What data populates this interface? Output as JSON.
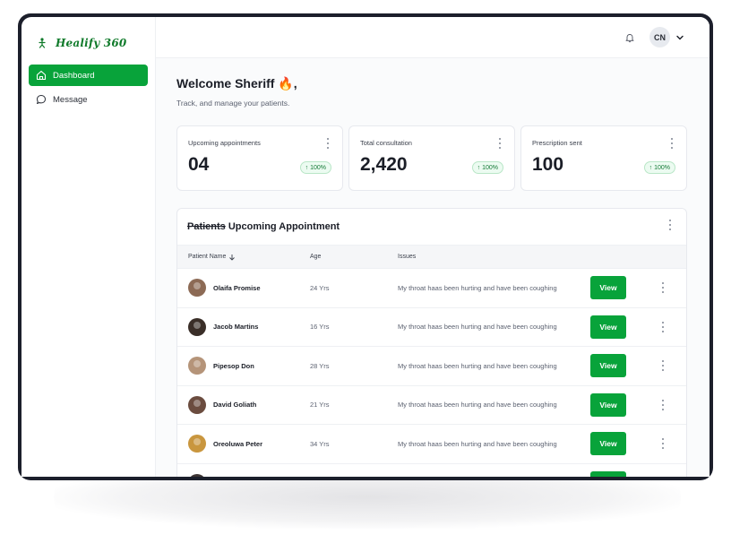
{
  "brand": {
    "name": "Healify 360",
    "color": "#0f7a2a"
  },
  "sidebar": {
    "items": [
      {
        "label": "Dashboard",
        "icon": "home-icon",
        "active": true
      },
      {
        "label": "Message",
        "icon": "chat-bubble-icon",
        "active": false
      }
    ]
  },
  "topbar": {
    "avatar_initials": "CN",
    "icons": [
      "bell-icon",
      "chevron-down-icon"
    ]
  },
  "welcome": {
    "title": "Welcome Sheriff 🔥,",
    "subtitle": "Track, and manage your patients."
  },
  "stats": [
    {
      "label": "Upcoming appointments",
      "value": "04",
      "badge": "100%"
    },
    {
      "label": "Total consultation",
      "value": "2,420",
      "badge": "100%"
    },
    {
      "label": "Prescription sent",
      "value": "100",
      "badge": "100%"
    }
  ],
  "appointments": {
    "title_struck": "Patients",
    "title_rest": " Upcoming Appointment",
    "columns": {
      "name": "Patient Name",
      "age": "Age",
      "issues": "Issues"
    },
    "rows": [
      {
        "name": "Olaifa Promise",
        "age": "24 Yrs",
        "issue": "My throat haas been hurting and have been coughing",
        "action": "View",
        "avatar_color": "#8c6a55"
      },
      {
        "name": "Jacob Martins",
        "age": "16 Yrs",
        "issue": "My throat haas been hurting and have been coughing",
        "action": "View",
        "avatar_color": "#3a2e28"
      },
      {
        "name": "Pipesop Don",
        "age": "28 Yrs",
        "issue": "My throat haas been hurting and have been coughing",
        "action": "View",
        "avatar_color": "#b59479"
      },
      {
        "name": "David Goliath",
        "age": "21 Yrs",
        "issue": "My throat haas been hurting and have been coughing",
        "action": "View",
        "avatar_color": "#6b4c3f"
      },
      {
        "name": "Oreoluwa Peter",
        "age": "34 Yrs",
        "issue": "My throat haas been hurting and have been coughing",
        "action": "View",
        "avatar_color": "#c9963e"
      },
      {
        "name": "",
        "age": "",
        "issue": "",
        "action": "",
        "avatar_color": "#3d3433"
      }
    ]
  },
  "colors": {
    "accent": "#08a33a",
    "badge_bg": "#ecfbf1",
    "frame": "#1c1f2b"
  }
}
